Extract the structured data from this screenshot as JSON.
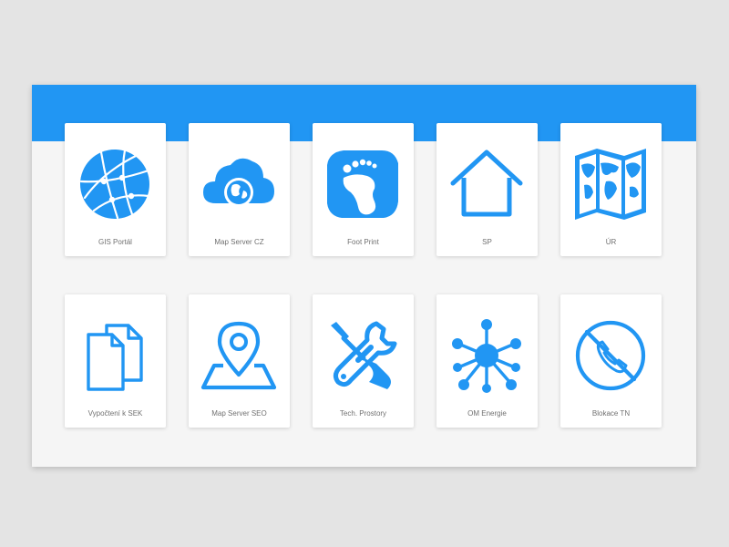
{
  "colors": {
    "accent": "#2196f3",
    "panel_background": "#f5f5f5",
    "tile_background": "#ffffff",
    "label_text": "#707070"
  },
  "tiles": [
    {
      "label": "GIS Portál",
      "icon": "globe-network-icon"
    },
    {
      "label": "Map Server CZ",
      "icon": "cloud-globe-icon"
    },
    {
      "label": "Foot Print",
      "icon": "footprint-icon"
    },
    {
      "label": "SP",
      "icon": "home-icon"
    },
    {
      "label": "ÚR",
      "icon": "world-map-icon"
    },
    {
      "label": "Vypočtení k SEK",
      "icon": "documents-icon"
    },
    {
      "label": "Map Server SEO",
      "icon": "map-pin-icon"
    },
    {
      "label": "Tech. Prostory",
      "icon": "tools-icon"
    },
    {
      "label": "OM Energie",
      "icon": "network-hub-icon"
    },
    {
      "label": "Blokace TN",
      "icon": "blocked-phone-icon"
    }
  ]
}
